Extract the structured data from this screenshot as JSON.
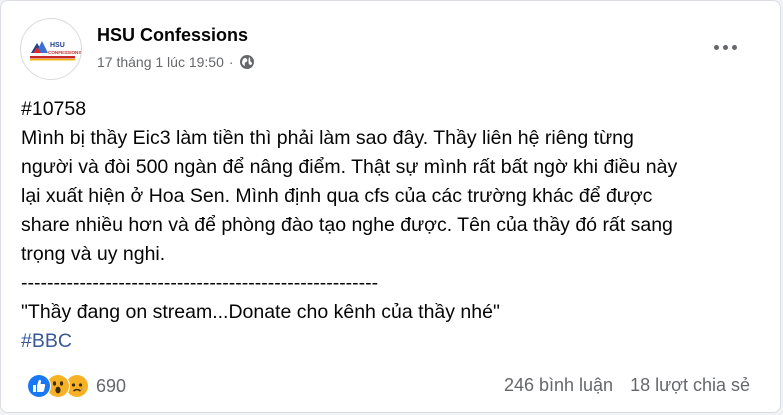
{
  "post": {
    "author": "HSU Confessions",
    "timestamp": "17 tháng 1 lúc 19:50",
    "separator": "·",
    "privacy_icon": "globe-icon",
    "more_icon": "more-options-icon",
    "avatar_logo_text": "HSU",
    "avatar_logo_subtext": "CONFESSIONS",
    "id_tag": "#10758",
    "body_lines": [
      "Mình bị thầy Eic3 làm tiền thì phải làm sao đây. Thầy liên hệ riêng từng",
      "người và đòi 500 ngàn để nâng điểm. Thật sự mình rất bất ngờ khi điều này",
      "lại xuất hiện ở Hoa Sen. Mình định qua cfs của các trường khác để được",
      "share nhiều hơn và để phòng đào tạo nghe được. Tên của thầy đó rất sang",
      "trọng và uy nghi."
    ],
    "divider": "-------------------------------------------------------",
    "quote": "\"Thầy đang on stream...Donate cho kênh của thầy nhé\"",
    "hashtag": "#BBC"
  },
  "footer": {
    "reaction_icons": [
      "like-icon",
      "wow-icon",
      "sad-icon"
    ],
    "reaction_count": "690",
    "comments": "246 bình luận",
    "shares": "18 lượt chia sẻ"
  },
  "colors": {
    "link": "#385898",
    "secondary_text": "#65676b",
    "like_blue": "#1877f2",
    "reaction_yellow": "#f7b125"
  }
}
